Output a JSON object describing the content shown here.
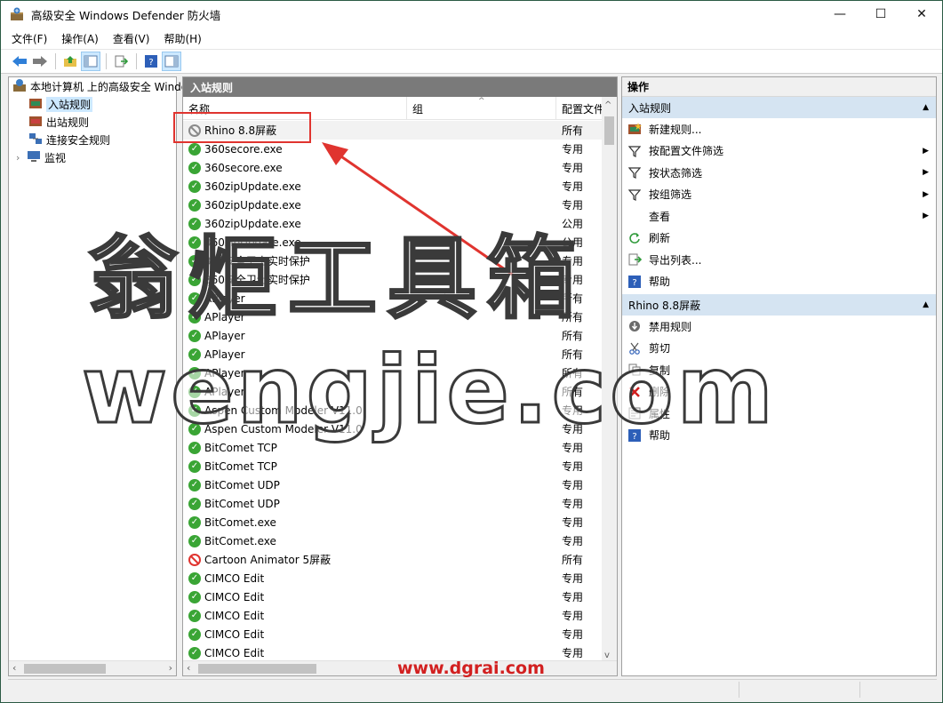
{
  "window": {
    "title": "高级安全 Windows Defender 防火墙",
    "minimize": "—",
    "maximize": "☐",
    "close": "✕"
  },
  "menu": [
    "文件(F)",
    "操作(A)",
    "查看(V)",
    "帮助(H)"
  ],
  "tree": {
    "root": "本地计算机 上的高级安全 Windows Defender",
    "items": [
      "入站规则",
      "出站规则",
      "连接安全规则",
      "监视"
    ]
  },
  "center": {
    "header": "入站规则",
    "columns": [
      "名称",
      "组",
      "配置文件"
    ],
    "rows": [
      {
        "name": "Rhino 8.8屏蔽",
        "profile": "所有",
        "status": "disabled"
      },
      {
        "name": "360secore.exe",
        "profile": "专用",
        "status": "ok"
      },
      {
        "name": "360secore.exe",
        "profile": "专用",
        "status": "ok"
      },
      {
        "name": "360zipUpdate.exe",
        "profile": "专用",
        "status": "ok"
      },
      {
        "name": "360zipUpdate.exe",
        "profile": "专用",
        "status": "ok"
      },
      {
        "name": "360zipUpdate.exe",
        "profile": "公用",
        "status": "ok"
      },
      {
        "name": "360zipUpdate.exe",
        "profile": "公用",
        "status": "ok"
      },
      {
        "name": "360安全卫士实时保护",
        "profile": "专用",
        "status": "ok"
      },
      {
        "name": "360安全卫士实时保护",
        "profile": "专用",
        "status": "ok"
      },
      {
        "name": "APlayer",
        "profile": "所有",
        "status": "ok"
      },
      {
        "name": "APlayer",
        "profile": "所有",
        "status": "ok"
      },
      {
        "name": "APlayer",
        "profile": "所有",
        "status": "ok"
      },
      {
        "name": "APlayer",
        "profile": "所有",
        "status": "ok"
      },
      {
        "name": "APlayer",
        "profile": "所有",
        "status": "ok"
      },
      {
        "name": "APlayer",
        "profile": "所有",
        "status": "ok"
      },
      {
        "name": "Aspen Custom Modeler V11.0",
        "profile": "专用",
        "status": "ok"
      },
      {
        "name": "Aspen Custom Modeler V11.0",
        "profile": "专用",
        "status": "ok"
      },
      {
        "name": "BitComet TCP",
        "profile": "专用",
        "status": "ok"
      },
      {
        "name": "BitComet TCP",
        "profile": "专用",
        "status": "ok"
      },
      {
        "name": "BitComet UDP",
        "profile": "专用",
        "status": "ok"
      },
      {
        "name": "BitComet UDP",
        "profile": "专用",
        "status": "ok"
      },
      {
        "name": "BitComet.exe",
        "profile": "专用",
        "status": "ok"
      },
      {
        "name": "BitComet.exe",
        "profile": "专用",
        "status": "ok"
      },
      {
        "name": "Cartoon Animator 5屏蔽",
        "profile": "所有",
        "status": "block"
      },
      {
        "name": "CIMCO Edit",
        "profile": "专用",
        "status": "ok"
      },
      {
        "name": "CIMCO Edit",
        "profile": "专用",
        "status": "ok"
      },
      {
        "name": "CIMCO Edit",
        "profile": "专用",
        "status": "ok"
      },
      {
        "name": "CIMCO Edit",
        "profile": "专用",
        "status": "ok"
      },
      {
        "name": "CIMCO Edit",
        "profile": "专用",
        "status": "ok"
      }
    ]
  },
  "actions": {
    "header": "操作",
    "section1": "入站规则",
    "section1_items": [
      {
        "label": "新建规则...",
        "icon": "new-rule-icon",
        "sub": false
      },
      {
        "label": "按配置文件筛选",
        "icon": "filter-icon",
        "sub": true
      },
      {
        "label": "按状态筛选",
        "icon": "filter-icon",
        "sub": true
      },
      {
        "label": "按组筛选",
        "icon": "filter-icon",
        "sub": true
      },
      {
        "label": "查看",
        "icon": "",
        "sub": true
      },
      {
        "label": "刷新",
        "icon": "refresh-icon",
        "sub": false
      },
      {
        "label": "导出列表...",
        "icon": "export-icon",
        "sub": false
      },
      {
        "label": "帮助",
        "icon": "help-icon",
        "sub": false
      }
    ],
    "section2": "Rhino 8.8屏蔽",
    "section2_items": [
      {
        "label": "禁用规则",
        "icon": "disable-icon"
      },
      {
        "label": "剪切",
        "icon": "cut-icon"
      },
      {
        "label": "复制",
        "icon": "copy-icon"
      },
      {
        "label": "删除",
        "icon": "delete-icon"
      },
      {
        "label": "属性",
        "icon": "properties-icon"
      },
      {
        "label": "帮助",
        "icon": "help-icon"
      }
    ]
  },
  "watermark": {
    "cn": "翁炬工具箱",
    "en": "wengjie.com",
    "footer": "www.dgrai.com"
  },
  "colors": {
    "selection": "#cce8ff",
    "callout": "#e0342f",
    "ok": "#3aa535",
    "section": "#d5e4f2"
  }
}
